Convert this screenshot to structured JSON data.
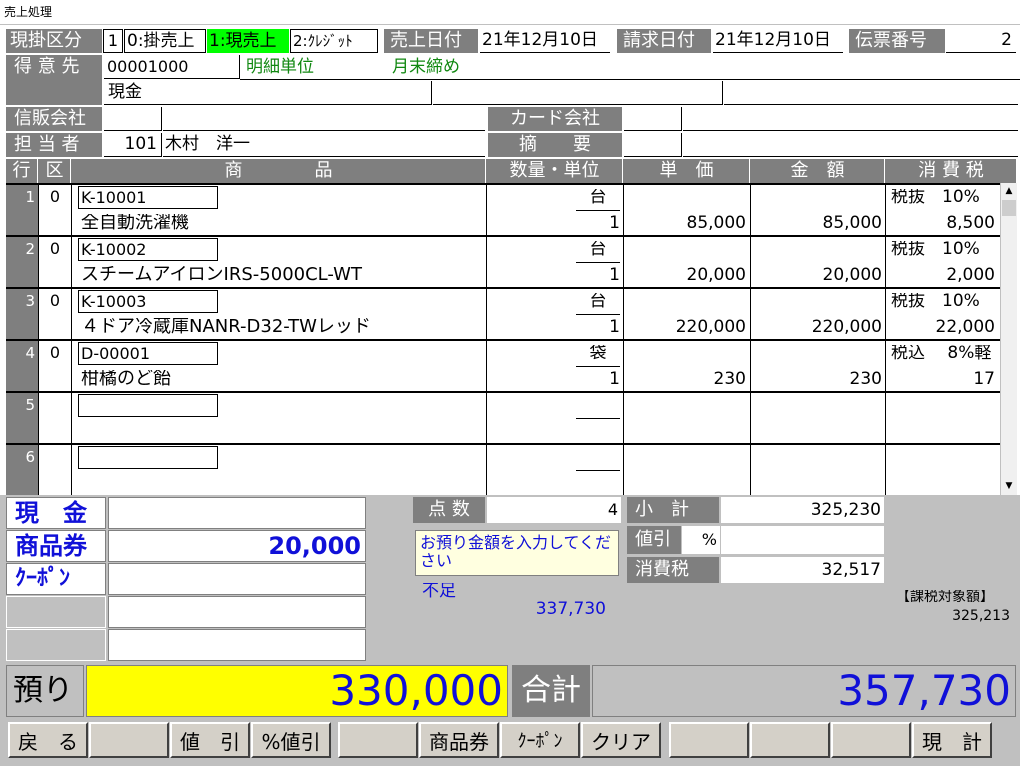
{
  "window": {
    "title": "売上処理"
  },
  "header": {
    "kake_label": "現掛区分",
    "kake_current": "1",
    "kake_opt0": "0:掛売上",
    "kake_opt1": "1:現売上",
    "kake_opt2": "2:ｸﾚｼﾞｯﾄ",
    "sales_date_label": "売上日付",
    "sales_date": "21年12月10日",
    "bill_date_label": "請求日付",
    "bill_date": "21年12月10日",
    "slip_label": "伝票番号",
    "slip_no": "2",
    "customer_label": "得 意 先",
    "customer_code": "00001000",
    "detail_unit": "明細単位",
    "closing": "月末締め",
    "customer_name": "現金",
    "credit_label": "信販会社",
    "card_label": "カード会社",
    "staff_label": "担 当 者",
    "staff_code": "101",
    "staff_name": "木村　洋一",
    "memo_label": "摘　　要"
  },
  "table": {
    "col_row": "行",
    "col_kubun": "区",
    "col_item": "商　　　　品",
    "col_qty": "数量・単位",
    "col_price": "単　価",
    "col_amount": "金　額",
    "col_tax": "消 費 税",
    "rows": [
      {
        "no": "1",
        "kubun": "0",
        "code": "K-10001",
        "name": "全自動洗濯機",
        "unit": "台",
        "qty": "1",
        "price": "85,000",
        "amount": "85,000",
        "tax_type": "税抜　10%",
        "tax": "8,500"
      },
      {
        "no": "2",
        "kubun": "0",
        "code": "K-10002",
        "name": "スチームアイロンIRS-5000CL-WT",
        "unit": "台",
        "qty": "1",
        "price": "20,000",
        "amount": "20,000",
        "tax_type": "税抜　10%",
        "tax": "2,000"
      },
      {
        "no": "3",
        "kubun": "0",
        "code": "K-10003",
        "name": "４ドア冷蔵庫NANR-D32-TWレッド",
        "unit": "台",
        "qty": "1",
        "price": "220,000",
        "amount": "220,000",
        "tax_type": "税抜　10%",
        "tax": "22,000"
      },
      {
        "no": "4",
        "kubun": "0",
        "code": "D-00001",
        "name": "柑橘のど飴",
        "unit": "袋",
        "qty": "1",
        "price": "230",
        "amount": "230",
        "tax_type": "税込　 8%軽",
        "tax": "17"
      },
      {
        "no": "5",
        "kubun": "",
        "code": "",
        "name": "",
        "unit": "",
        "qty": "",
        "price": "",
        "amount": "",
        "tax_type": "",
        "tax": ""
      },
      {
        "no": "6",
        "kubun": "",
        "code": "",
        "name": "",
        "unit": "",
        "qty": "",
        "price": "",
        "amount": "",
        "tax_type": "",
        "tax": ""
      }
    ]
  },
  "payment": {
    "cash_label": "現　金",
    "cash_value": "",
    "voucher_label": "商品券",
    "voucher_value": "20,000",
    "coupon_label": "ｸｰﾎﾟﾝ",
    "coupon_value": ""
  },
  "summary": {
    "points_label": "点 数",
    "points": "4",
    "message": "お預り金額を入力してください",
    "shortage_label": "不足",
    "shortage": "337,730",
    "subtotal_label": "小　計",
    "subtotal": "325,230",
    "discount_label": "値引",
    "discount_pct_sign": "%",
    "tax_label": "消費税",
    "tax": "32,517",
    "taxable_label": "【課税対象額】",
    "taxable": "325,213",
    "received_label": "預り",
    "received": "330,000",
    "total_label": "合計",
    "total": "357,730"
  },
  "buttons": {
    "back": "戻　る",
    "discount": "値　引",
    "pct_discount": "%値引",
    "voucher": "商品券",
    "coupon": "ｸｰﾎﾟﾝ",
    "clear": "クリア",
    "checkout": "現　計"
  },
  "colors": {
    "highlight": "#00ff00",
    "received_bg": "#ffff00",
    "accent_blue": "#1010d8",
    "label_gray": "#7f7f7f"
  }
}
